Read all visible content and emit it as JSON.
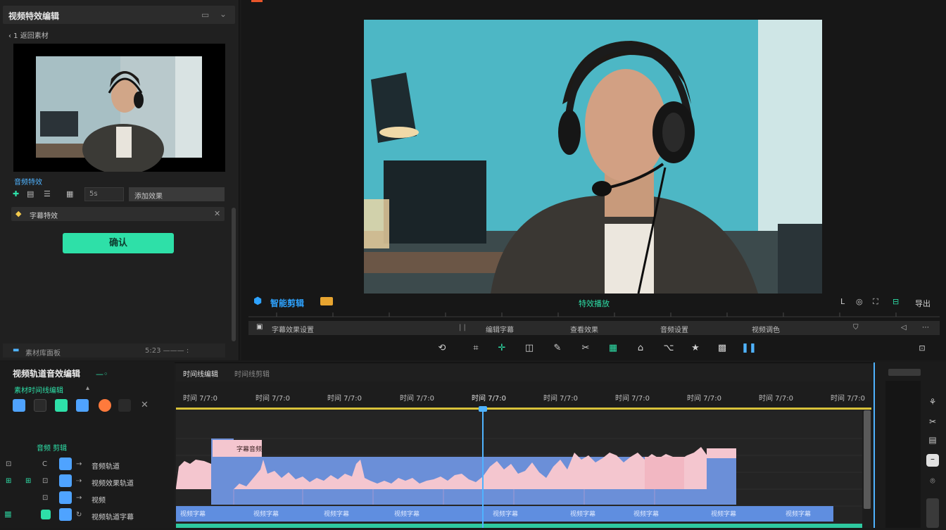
{
  "left_panel": {
    "title": "视频特效编辑",
    "back_label": "‹ 1 返回素材",
    "section_label": "音频特效",
    "small_input": "5s",
    "dropdown_value": "添加效果",
    "text_row_label": "字幕特效",
    "confirm_label": "确认",
    "footer_label": "素材库面板",
    "footer_right": "5:23 ——— :"
  },
  "preview": {
    "left_label": "智能剪辑",
    "center_label": "特效播放",
    "right_label": "导出",
    "info_left": "字幕效果设置",
    "info_mid": "编辑字幕",
    "info_mid2": "查看效果",
    "info_right1": "音频设置",
    "info_right2": "视频调色"
  },
  "toolbar": {
    "icons": [
      "loop-icon",
      "crop-icon",
      "split-icon",
      "frame-icon",
      "pen-icon",
      "scissor-icon",
      "mark-icon",
      "stamp-icon",
      "trim-icon",
      "star-icon",
      "grid-icon",
      "pause-icon"
    ]
  },
  "bottom": {
    "track_title": "视频轨道音效编辑",
    "track_sub": "素材时间线编辑",
    "track_group_label": "音频 剪辑",
    "track_rows": [
      "音频轨道",
      "视频效果轨道",
      "视频",
      "视频轨道字幕"
    ],
    "tab_active": "时间线编辑",
    "tab_inactive": "时间线剪辑",
    "timecodes": [
      "时间 7/7:0",
      "时间 7/7:0",
      "时间 7/7:0",
      "时间 7/7:0",
      "时间 7/7:0",
      "时间 7/7:0",
      "时间 7/7:0",
      "时间 7/7:0",
      "时间 7/7:0",
      "时间 7/7:0"
    ],
    "clip_label": "字幕音频",
    "subtitle_clip": "视频字幕"
  }
}
